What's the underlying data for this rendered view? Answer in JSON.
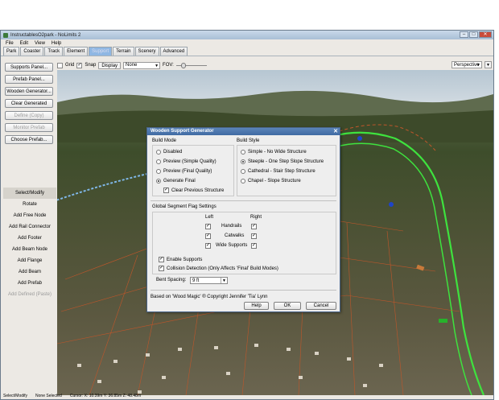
{
  "window": {
    "title": "InstructablesO2park - NoLimits 2",
    "controls": [
      "–",
      "□",
      "✕"
    ]
  },
  "menu": [
    "File",
    "Edit",
    "View",
    "Help"
  ],
  "tabs": [
    {
      "label": "Park"
    },
    {
      "label": "Coaster"
    },
    {
      "label": "Track"
    },
    {
      "label": "Element"
    },
    {
      "label": "Support",
      "active": true
    },
    {
      "label": "Terrain"
    },
    {
      "label": "Scenery"
    },
    {
      "label": "Advanced"
    }
  ],
  "toolbar": {
    "grid_label": "Grid",
    "snap_label": "Snap",
    "display_label": "Display",
    "none_value": "None",
    "fov_label": "FOV:",
    "fov_level": 0.2,
    "view_mode": "Perspective"
  },
  "sidebar": {
    "buttons": [
      {
        "label": "Supports Panel..."
      },
      {
        "label": "Prefab Panel..."
      },
      {
        "label": "Wooden Generator..."
      },
      {
        "label": "Clear Generated"
      },
      {
        "label": "Define (Copy)",
        "disabled": true
      },
      {
        "label": "Monitor Prefab",
        "disabled": true
      },
      {
        "label": "Choose Prefab..."
      }
    ],
    "tools": [
      {
        "label": "Select/Modify",
        "selected": true
      },
      {
        "label": "Rotate"
      },
      {
        "label": "Add Free Node"
      },
      {
        "label": "Add Rail Connector"
      },
      {
        "label": "Add Footer"
      },
      {
        "label": "Add Beam Node"
      },
      {
        "label": "Add Flange"
      },
      {
        "label": "Add Beam"
      },
      {
        "label": "Add Prefab"
      },
      {
        "label": "Add Defined (Paste)",
        "disabled": true
      }
    ]
  },
  "status": {
    "mode": "Select/Modify",
    "selection": "None Selected",
    "cursor": "Cursor: X: 10.39m Y: 36.85m Z: 48.48m"
  },
  "dialog": {
    "title": "Wooden Support Generator",
    "build_mode": {
      "heading": "Build Mode",
      "options": [
        {
          "label": "Disabled",
          "selected": false
        },
        {
          "label": "Preview (Simple Quality)",
          "selected": false
        },
        {
          "label": "Preview (Final Quality)",
          "selected": false
        },
        {
          "label": "Generate Final",
          "selected": true
        }
      ],
      "clear_previous": {
        "label": "Clear Previous Structure",
        "checked": true
      }
    },
    "build_style": {
      "heading": "Build Style",
      "options": [
        {
          "label": "Simple - No Wide Structure",
          "selected": false
        },
        {
          "label": "Steeple - One Step Slope Structure",
          "selected": true
        },
        {
          "label": "Cathedral - Stair Step Structure",
          "selected": false
        },
        {
          "label": "Chapel - Slope Structure",
          "selected": false
        }
      ]
    },
    "segment_flags": {
      "heading": "Global Segment Flag Settings",
      "left_label": "Left",
      "right_label": "Right",
      "rows": [
        {
          "label": "Handrails",
          "left": true,
          "right": true
        },
        {
          "label": "Catwalks",
          "left": true,
          "right": true
        },
        {
          "label": "Wide Supports",
          "left": true,
          "right": true
        }
      ]
    },
    "enable_supports": {
      "label": "Enable Supports",
      "checked": true
    },
    "collision_detection": {
      "label": "Collision Detection (Only Affects 'Final' Build Modes)",
      "checked": true
    },
    "bent_spacing": {
      "label": "Bent Spacing:",
      "value": "9 ft"
    },
    "credit": "Based on 'Wood Magic' ® Copyright Jennifer 'Tia' Lynn",
    "buttons": {
      "help": "Help",
      "ok": "OK",
      "cancel": "Cancel"
    }
  },
  "colors": {
    "track_green": "#3ee23e",
    "support_orange": "#c0562a",
    "sky": "#c9d4dc",
    "grass": "#46542f",
    "title_blue": "#4a74ad"
  }
}
